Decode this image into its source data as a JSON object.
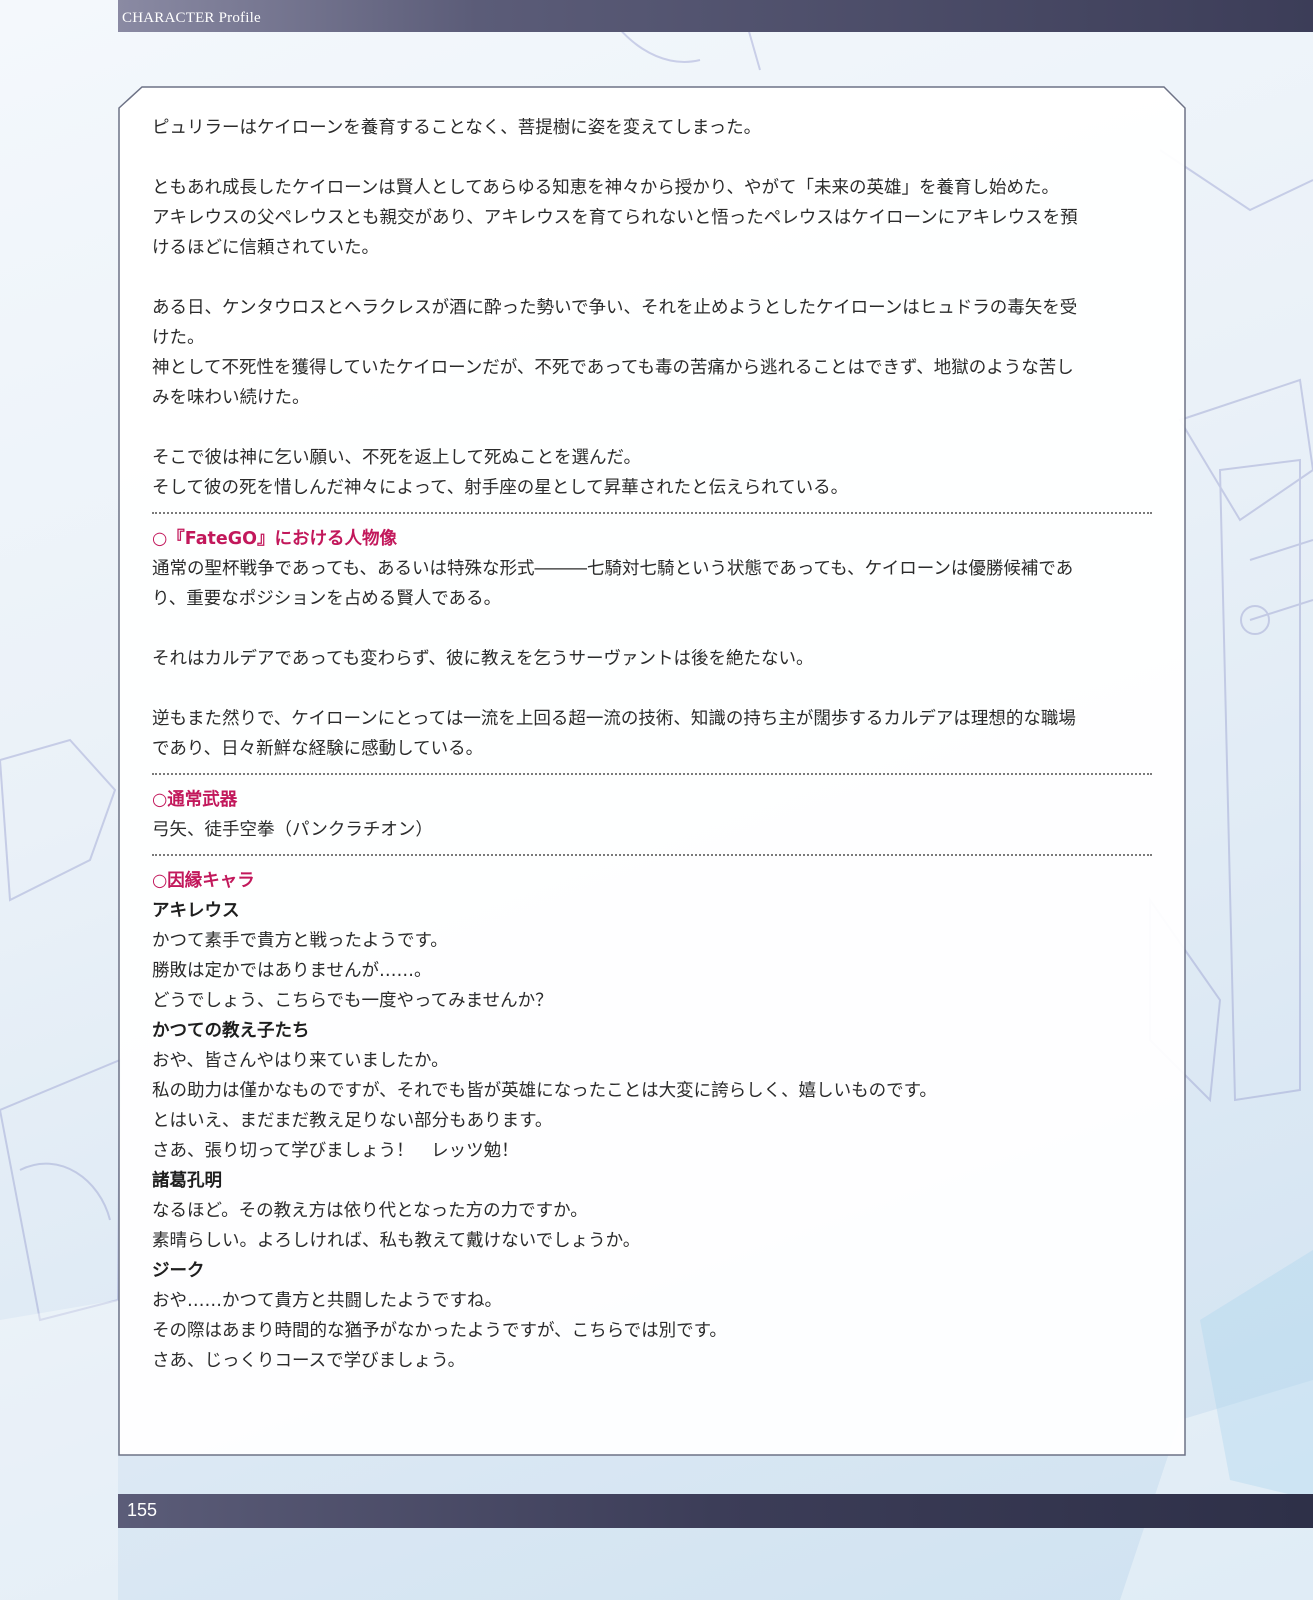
{
  "header": {
    "title": "CHARACTER Profile"
  },
  "footer": {
    "page_number": "155"
  },
  "legend_section": {
    "paragraphs": [
      [
        "ピュリラーはケイローンを養育することなく、菩提樹に姿を変えてしまった。"
      ],
      [
        "ともあれ成長したケイローンは賢人としてあらゆる知恵を神々から授かり、やがて「未来の英雄」を養育し始めた。",
        "アキレウスの父ペレウスとも親交があり、アキレウスを育てられないと悟ったペレウスはケイローンにアキレウスを預",
        "けるほどに信頼されていた。"
      ],
      [
        "ある日、ケンタウロスとヘラクレスが酒に酔った勢いで争い、それを止めようとしたケイローンはヒュドラの毒矢を受",
        "けた。",
        "神として不死性を獲得していたケイローンだが、不死であっても毒の苦痛から逃れることはできず、地獄のような苦し",
        "みを味わい続けた。"
      ],
      [
        "そこで彼は神に乞い願い、不死を返上して死ぬことを選んだ。",
        "そして彼の死を惜しんだ神々によって、射手座の星として昇華されたと伝えられている。"
      ]
    ]
  },
  "fatego_section": {
    "heading": "○『FateGO』における人物像",
    "paragraphs": [
      [
        "通常の聖杯戦争であっても、あるいは特殊な形式―――七騎対七騎という状態であっても、ケイローンは優勝候補であ",
        "り、重要なポジションを占める賢人である。"
      ],
      [
        "それはカルデアであっても変わらず、彼に教えを乞うサーヴァントは後を絶たない。"
      ],
      [
        "逆もまた然りで、ケイローンにとっては一流を上回る超一流の技術、知識の持ち主が闊歩するカルデアは理想的な職場",
        "であり、日々新鮮な経験に感動している。"
      ]
    ]
  },
  "weapons_section": {
    "heading": "○通常武器",
    "text": "弓矢、徒手空拳（パンクラチオン）"
  },
  "relations_section": {
    "heading": "○因縁キャラ",
    "characters": [
      {
        "name": "アキレウス",
        "lines": [
          "かつて素手で貴方と戦ったようです。",
          "勝敗は定かではありませんが……。",
          "どうでしょう、こちらでも一度やってみませんか？"
        ]
      },
      {
        "name": "かつての教え子たち",
        "lines": [
          "おや、皆さんやはり来ていましたか。",
          "私の助力は僅かなものですが、それでも皆が英雄になったことは大変に誇らしく、嬉しいものです。",
          "とはいえ、まだまだ教え足りない部分もあります。",
          "さあ、張り切って学びましょう！　レッツ勉！"
        ]
      },
      {
        "name": "諸葛孔明",
        "lines": [
          "なるほど。その教え方は依り代となった方の力ですか。",
          "素晴らしい。よろしければ、私も教えて戴けないでしょうか。"
        ]
      },
      {
        "name": "ジーク",
        "lines": [
          "おや……かつて貴方と共闘したようですね。",
          "その際はあまり時間的な猶予がなかったようですが、こちらでは別です。",
          "さあ、じっくりコースで学びましょう。"
        ]
      }
    ]
  }
}
